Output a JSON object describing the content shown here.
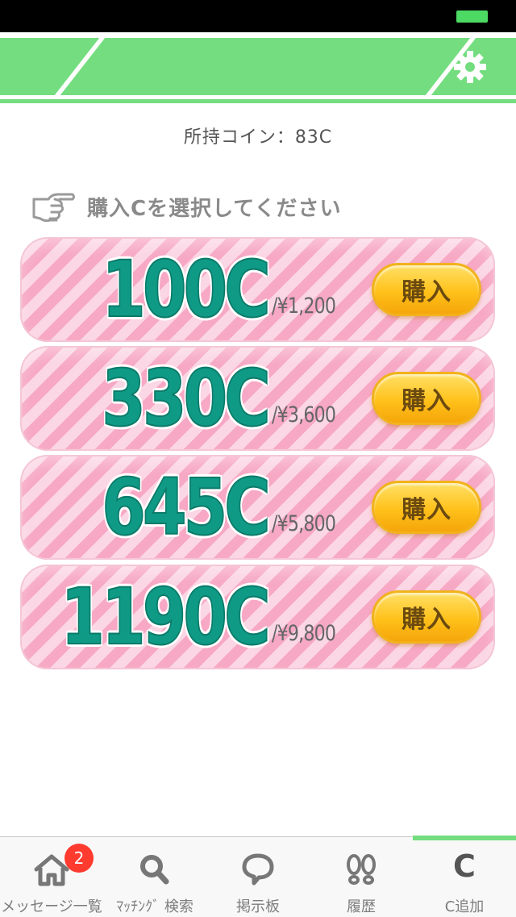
{
  "header": {
    "settings_icon": "gear-icon"
  },
  "coins": {
    "label": "所持コイン：83C"
  },
  "prompt": {
    "text": "購入Cを選択してください",
    "icon": "pointing-hand-icon"
  },
  "plans": [
    {
      "amount": "100C",
      "price": "/¥1,200",
      "button": "購入"
    },
    {
      "amount": "330C",
      "price": "/¥3,600",
      "button": "購入"
    },
    {
      "amount": "645C",
      "price": "/¥5,800",
      "button": "購入"
    },
    {
      "amount": "1190C",
      "price": "/¥9,800",
      "button": "購入"
    }
  ],
  "tabs": [
    {
      "label": "メッセージ一覧",
      "icon": "home-icon",
      "badge": "2"
    },
    {
      "label": "ﾏｯﾁﾝｸﾞ 検索",
      "icon": "search-icon"
    },
    {
      "label": "掲示板",
      "icon": "speech-bubble-icon"
    },
    {
      "label": "履歴",
      "icon": "footprints-icon"
    },
    {
      "label": "C追加",
      "icon": "c-icon",
      "icon_text": "C",
      "active": true
    }
  ],
  "colors": {
    "accent": "#74dd7f",
    "amount": "#0f9a86",
    "button": "#ffc11a",
    "badge": "#ff3b30"
  }
}
